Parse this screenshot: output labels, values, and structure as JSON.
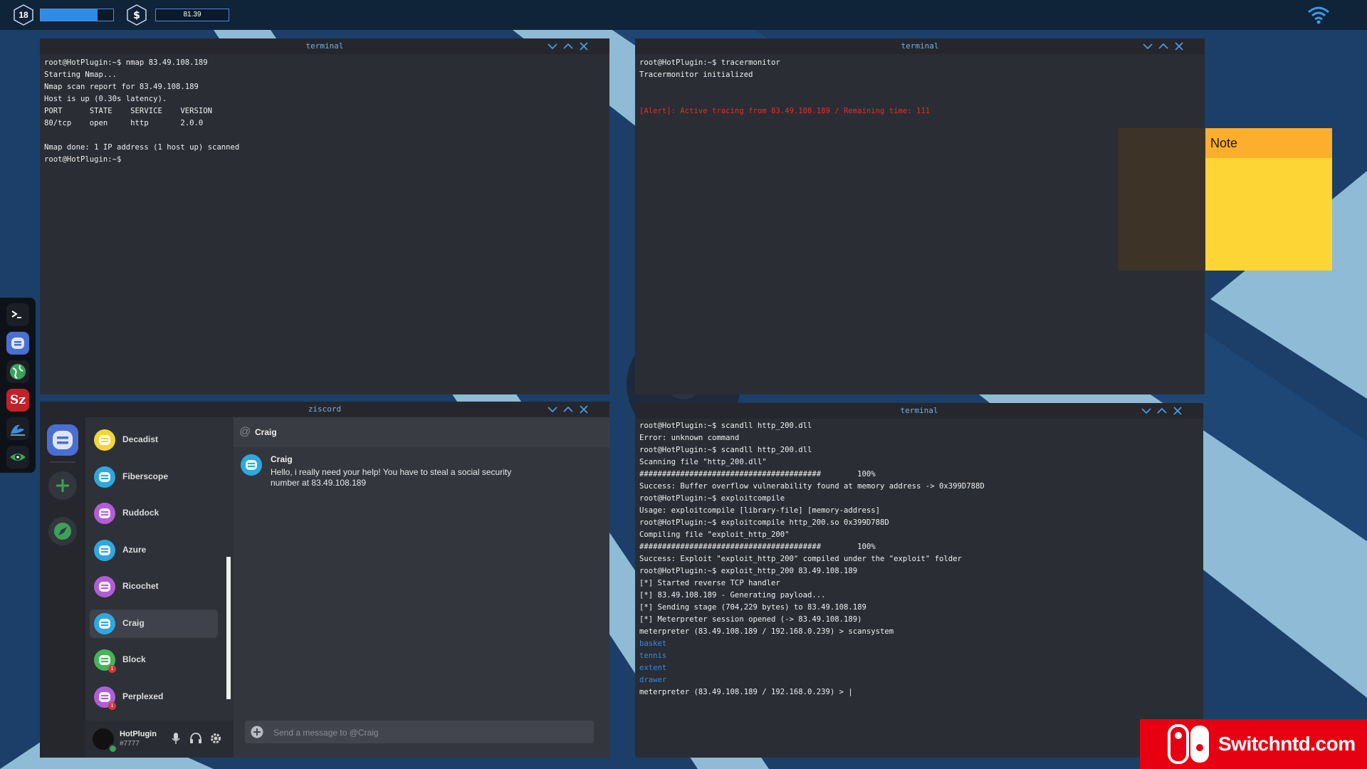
{
  "topbar": {
    "level": "18",
    "xp_fraction": 0.78,
    "money": "81.39"
  },
  "dock": {
    "items": [
      "terminal-icon",
      "ziscord-icon",
      "browser-icon",
      "sz-icon",
      "wave-icon",
      "eye-icon"
    ]
  },
  "terminal1": {
    "title": "terminal",
    "lines": [
      "root@HotPlugin:~$ nmap 83.49.108.189",
      "Starting Nmap...",
      "Nmap scan report for 83.49.108.189",
      "Host is up (0.30s latency).",
      "PORT      STATE    SERVICE    VERSION",
      "80/tcp    open     http       2.0.0",
      "",
      "Nmap done: 1 IP address (1 host up) scanned",
      "root@HotPlugin:~$"
    ]
  },
  "terminal2": {
    "title": "terminal",
    "lines": [
      "root@HotPlugin:~$ tracermonitor",
      "Tracermonitor initialized",
      "",
      ""
    ],
    "alert": "[Alert]: Active tracing from 83.49.108.189 / Remaining time: 111"
  },
  "note": {
    "title": "Note"
  },
  "ziscord": {
    "title": "ziscord",
    "contacts": [
      {
        "name": "Decadist",
        "color": "#f1d63a",
        "badge": ""
      },
      {
        "name": "Fiberscope",
        "color": "#2fa7df",
        "badge": ""
      },
      {
        "name": "Ruddock",
        "color": "#b15ed6",
        "badge": ""
      },
      {
        "name": "Azure",
        "color": "#2fa7df",
        "badge": ""
      },
      {
        "name": "Ricochet",
        "color": "#b15ed6",
        "badge": ""
      },
      {
        "name": "Craig",
        "color": "#2fa7df",
        "badge": ""
      },
      {
        "name": "Block",
        "color": "#44b35a",
        "badge": "1"
      },
      {
        "name": "Perplexed",
        "color": "#b15ed6",
        "badge": "1"
      }
    ],
    "active_contact": "Craig",
    "chat_header": "Craig",
    "message": {
      "author": "Craig",
      "text": "Hello, i really need your help! You have to steal a social security number at 83.49.108.189"
    },
    "input_placeholder": "Send a message to @Craig",
    "user": {
      "name": "HotPlugin",
      "tag": "#7777"
    }
  },
  "terminal3": {
    "title": "terminal",
    "lines": [
      {
        "text": "root@HotPlugin:~$ scandll http_200.dll",
        "style": ""
      },
      {
        "text": "Error: unknown command",
        "style": ""
      },
      {
        "text": "root@HotPlugin:~$ scandll http_200.dll",
        "style": ""
      },
      {
        "text": "Scanning file \"http_200.dll\"",
        "style": ""
      },
      {
        "text": "########################################        100%",
        "style": ""
      },
      {
        "text": "Success: Buffer overflow vulnerability found at memory address -> 0x399D788D",
        "style": ""
      },
      {
        "text": "root@HotPlugin:~$ exploitcompile",
        "style": ""
      },
      {
        "text": "Usage: exploitcompile [library-file] [memory-address]",
        "style": ""
      },
      {
        "text": "root@HotPlugin:~$ exploitcompile http_200.so 0x399D788D",
        "style": ""
      },
      {
        "text": "Compiling file \"exploit_http_200\"",
        "style": ""
      },
      {
        "text": "########################################        100%",
        "style": ""
      },
      {
        "text": "Success: Exploit \"exploit_http_200\" compiled under the \"exploit\" folder",
        "style": ""
      },
      {
        "text": "root@HotPlugin:~$ exploit_http_200 83.49.108.189",
        "style": ""
      },
      {
        "text": "[*] Started reverse TCP handler",
        "style": ""
      },
      {
        "text": "[*] 83.49.108.189 - Generating payload...",
        "style": ""
      },
      {
        "text": "[*] Sending stage (704,229 bytes) to 83.49.108.189",
        "style": ""
      },
      {
        "text": "[*] Meterpreter session opened (-> 83.49.108.189)",
        "style": ""
      },
      {
        "text": "meterpreter (83.49.108.189 / 192.168.0.239) > scansystem",
        "style": ""
      },
      {
        "text": "basket",
        "style": "blue"
      },
      {
        "text": "tennis",
        "style": "blue"
      },
      {
        "text": "extent",
        "style": "blue"
      },
      {
        "text": "drawer",
        "style": "blue"
      },
      {
        "text": "meterpreter (83.49.108.189 / 192.168.0.239) > |",
        "style": ""
      }
    ]
  },
  "watermark": {
    "text": "Switchntd.com"
  },
  "colors": {
    "accent": "#2f8be8",
    "alert": "#e0302a",
    "note_head": "#fcae2d",
    "note_body": "#fdd535"
  }
}
